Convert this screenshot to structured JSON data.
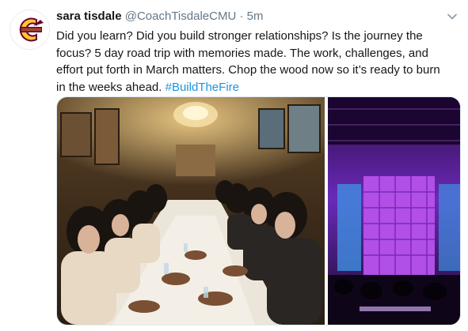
{
  "tweet": {
    "display_name": "sara tisdale",
    "handle": "@CoachTisdaleCMU",
    "separator": "·",
    "timestamp": "5m",
    "text": "Did you learn? Did you build stronger relationships? Is the journey the focus? 5 day road trip with memories made. The work, challenges, and effort put forth in March matters. Chop the wood now so it’s ready to burn in the weeks ahead.",
    "hashtag": "#BuildTheFire"
  },
  "colors": {
    "hashtag": "#1b95e0",
    "secondary_text": "#657786",
    "avatar_maroon": "#6a0032",
    "avatar_gold": "#ffc82e"
  },
  "icons": {
    "avatar": "cmu-chippewas-logo",
    "menu": "chevron-down-icon"
  },
  "media": {
    "images": [
      {
        "name": "team-dinner-photo"
      },
      {
        "name": "concert-stage-photo"
      }
    ]
  }
}
